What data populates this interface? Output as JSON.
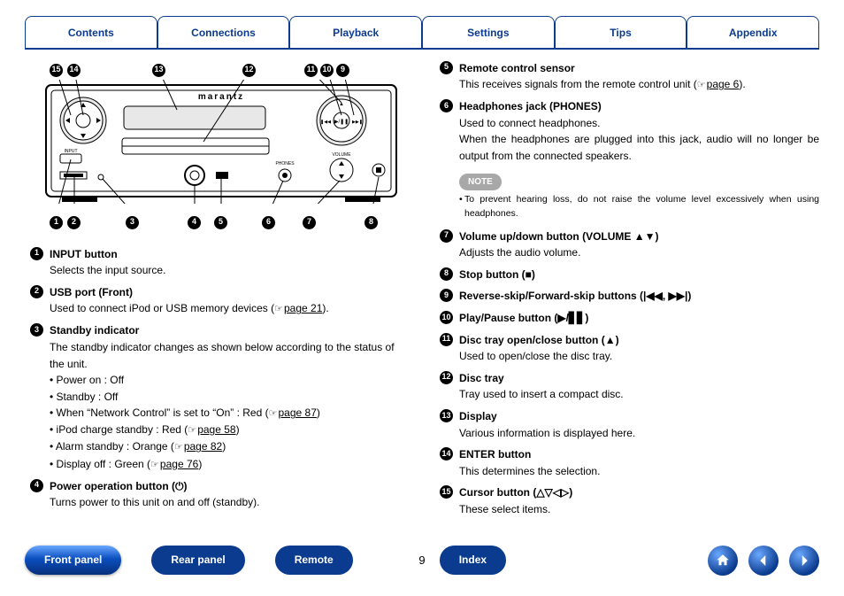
{
  "tabs": [
    "Contents",
    "Connections",
    "Playback",
    "Settings",
    "Tips",
    "Appendix"
  ],
  "brand": "marantz",
  "callouts_top": [
    "15",
    "14",
    "13",
    "12",
    "11",
    "10",
    "9"
  ],
  "callouts_bottom": [
    "1",
    "2",
    "3",
    "4",
    "5",
    "6",
    "7",
    "8"
  ],
  "left_entries": [
    {
      "n": "1",
      "title": "INPUT button",
      "desc": "Selects the input source."
    },
    {
      "n": "2",
      "title": "USB port (Front)",
      "desc": "Used to connect iPod or USB memory devices (",
      "pageref": "page 21",
      "desc_after": ")."
    },
    {
      "n": "3",
      "title": "Standby indicator",
      "desc": "The standby indicator changes as shown below according to the status of the unit.",
      "bullets": [
        {
          "t": "Power on : Off"
        },
        {
          "t": "Standby : Off"
        },
        {
          "t": "When  “Network Control” is set to “On” : Red (",
          "pageref": "page 87",
          "after": ")"
        },
        {
          "t": "iPod charge standby : Red (",
          "pageref": "page 58",
          "after": ")"
        },
        {
          "t": "Alarm standby : Orange (",
          "pageref": "page 82",
          "after": ")"
        },
        {
          "t": "Display off : Green (",
          "pageref": "page 76",
          "after": ")"
        }
      ]
    },
    {
      "n": "4",
      "title": "Power operation button (⏻)",
      "desc": "Turns power to this unit on and off (standby)."
    }
  ],
  "right_entries": [
    {
      "n": "5",
      "title": "Remote control sensor",
      "desc": "This receives signals from the remote control unit (",
      "pageref": "page 6",
      "desc_after": ")."
    },
    {
      "n": "6",
      "title": "Headphones jack (PHONES)",
      "desc": "Used to connect headphones.",
      "desc2": "When the headphones are plugged into this jack, audio will no longer be output from the connected speakers.",
      "note_label": "NOTE",
      "note": "To prevent hearing loss, do not raise the volume level excessively when using headphones."
    },
    {
      "n": "7",
      "title": "Volume up/down button (VOLUME ▲▼)",
      "desc": "Adjusts the audio volume."
    },
    {
      "n": "8",
      "title": "Stop button (■)"
    },
    {
      "n": "9",
      "title": "Reverse-skip/Forward-skip buttons (|◀◀, ▶▶|)"
    },
    {
      "n": "10",
      "title": "Play/Pause button (▶/▋▋)"
    },
    {
      "n": "11",
      "title": "Disc tray open/close button (▲)",
      "desc": "Used to open/close the disc tray."
    },
    {
      "n": "12",
      "title": "Disc tray",
      "desc": "Tray used to insert a compact disc."
    },
    {
      "n": "13",
      "title": "Display",
      "desc": "Various information is displayed here."
    },
    {
      "n": "14",
      "title": "ENTER button",
      "desc": "This determines the selection."
    },
    {
      "n": "15",
      "title": "Cursor button (△▽◁▷)",
      "desc": "These select items."
    }
  ],
  "bottom": {
    "front": "Front panel",
    "rear": "Rear panel",
    "remote": "Remote",
    "index": "Index",
    "page": "9"
  }
}
